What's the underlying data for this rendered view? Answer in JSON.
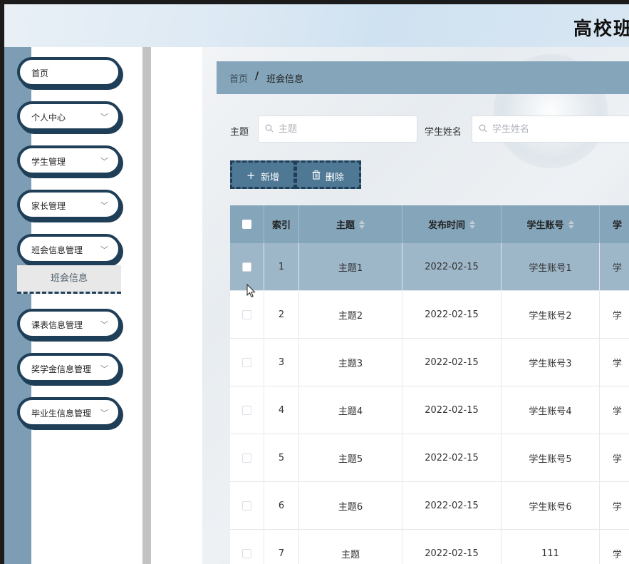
{
  "header": {
    "title": "高校班"
  },
  "sidebar": {
    "items": [
      {
        "label": "首页",
        "has_children": false
      },
      {
        "label": "个人中心",
        "has_children": true
      },
      {
        "label": "学生管理",
        "has_children": true
      },
      {
        "label": "家长管理",
        "has_children": true
      },
      {
        "label": "班会信息管理",
        "has_children": true
      },
      {
        "label": "课表信息管理",
        "has_children": true
      },
      {
        "label": "奖学金信息管理",
        "has_children": true
      },
      {
        "label": "毕业生信息管理",
        "has_children": true
      }
    ],
    "submenu": {
      "label": "班会信息"
    }
  },
  "breadcrumb": {
    "home": "首页",
    "separator": "/",
    "current": "班会信息"
  },
  "filters": {
    "topic_label": "主题",
    "topic_placeholder": "主题",
    "student_label": "学生姓名",
    "student_placeholder": "学生姓名"
  },
  "toolbar": {
    "add_label": "新增",
    "delete_label": "删除"
  },
  "table": {
    "headers": [
      "索引",
      "主题",
      "发布时间",
      "学生账号",
      "学"
    ],
    "rows": [
      {
        "index": "1",
        "topic": "主题1",
        "date": "2022-02-15",
        "account": "学生账号1",
        "more": "学",
        "highlight": true
      },
      {
        "index": "2",
        "topic": "主题2",
        "date": "2022-02-15",
        "account": "学生账号2",
        "more": "学"
      },
      {
        "index": "3",
        "topic": "主题3",
        "date": "2022-02-15",
        "account": "学生账号3",
        "more": "学"
      },
      {
        "index": "4",
        "topic": "主题4",
        "date": "2022-02-15",
        "account": "学生账号4",
        "more": "学"
      },
      {
        "index": "5",
        "topic": "主题5",
        "date": "2022-02-15",
        "account": "学生账号5",
        "more": "学"
      },
      {
        "index": "6",
        "topic": "主题6",
        "date": "2022-02-15",
        "account": "学生账号6",
        "more": "学"
      },
      {
        "index": "7",
        "topic": "主题",
        "date": "2022-02-15",
        "account": "111",
        "more": "学"
      }
    ]
  },
  "colors": {
    "accent": "#84a5ba",
    "sidebar": "#7c9db3",
    "border_dark": "#1f3e58",
    "button": "#4f7894"
  }
}
